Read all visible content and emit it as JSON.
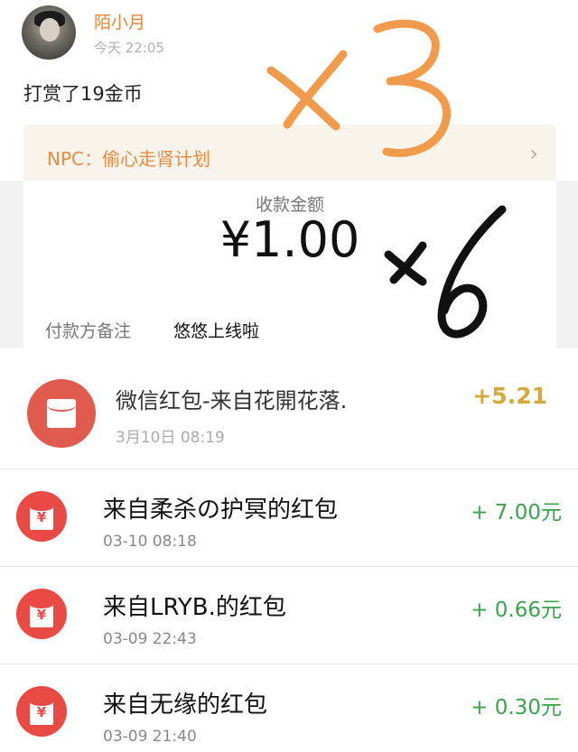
{
  "post": {
    "username": "陌小月",
    "time": "今天 22:05",
    "reward_text": "打赏了19金币",
    "npc_label": "NPC：偷心走肾计划",
    "npc_arrow": "›"
  },
  "receipt": {
    "title": "收款金额",
    "amount": "¥1.00",
    "remark_label": "付款方备注",
    "remark_value": "悠悠上线啦"
  },
  "transactions": {
    "first": {
      "title": "微信红包-来自花開花落.",
      "time": "3月10日 08:19",
      "amount": "+5.21"
    },
    "items": [
      {
        "title": "来自柔杀の护冥的红包",
        "time": "03-10 08:18",
        "amount": "+ 7.00元",
        "icon_text": "¥"
      },
      {
        "title": "来自LRYB.的红包",
        "time": "03-09 22:43",
        "amount": "+ 0.66元",
        "icon_text": "¥"
      },
      {
        "title": "来自无缘的红包",
        "time": "03-09 21:40",
        "amount": "+ 0.30元",
        "icon_text": "¥"
      }
    ]
  },
  "annotations": {
    "orange_mark": "×3",
    "black_mark": "×6"
  },
  "colors": {
    "accent_orange": "#e8843a",
    "envelope_red": "#ea4a44",
    "amount_green": "#3aa34b",
    "amount_gold": "#d6a83a"
  }
}
